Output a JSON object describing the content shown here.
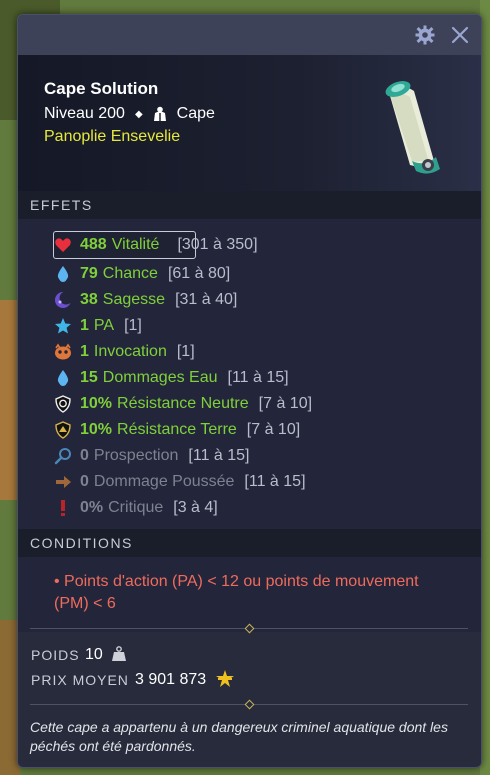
{
  "header": {
    "name": "Cape Solution",
    "level": "Niveau 200",
    "type": "Cape",
    "set": "Panoplie Ensevelie"
  },
  "effects_title": "EFFETS",
  "effects": [
    {
      "value": "488",
      "label": "Vitalité",
      "range": "[301 à 350]",
      "icon": "heart-icon",
      "active": true
    },
    {
      "value": "79",
      "label": "Chance",
      "range": "[61 à 80]",
      "icon": "water-drop-icon",
      "active": true
    },
    {
      "value": "38",
      "label": "Sagesse",
      "range": "[31 à 40]",
      "icon": "moon-icon",
      "active": true
    },
    {
      "value": "1",
      "label": "PA",
      "range": "[1]",
      "icon": "star-icon",
      "active": true
    },
    {
      "value": "1",
      "label": "Invocation",
      "range": "[1]",
      "icon": "invocation-icon",
      "active": true
    },
    {
      "value": "15",
      "label": "Dommages Eau",
      "range": "[11 à 15]",
      "icon": "water-drop-icon",
      "active": true
    },
    {
      "value": "10%",
      "label": "Résistance Neutre",
      "range": "[7 à 10]",
      "icon": "neutral-shield-icon",
      "active": true
    },
    {
      "value": "10%",
      "label": "Résistance Terre",
      "range": "[7 à 10]",
      "icon": "earth-shield-icon",
      "active": true
    },
    {
      "value": "0",
      "label": "Prospection",
      "range": "[11 à 15]",
      "icon": "magnifier-icon",
      "active": false
    },
    {
      "value": "0",
      "label": "Dommage Poussée",
      "range": "[11 à 15]",
      "icon": "push-arrow-icon",
      "active": false
    },
    {
      "value": "0%",
      "label": "Critique",
      "range": "[3 à 4]",
      "icon": "critical-icon",
      "active": false
    }
  ],
  "conditions_title": "CONDITIONS",
  "conditions_text": "• Points d'action (PA) < 12 ou points de mouvement (PM) < 6",
  "weight_label": "POIDS",
  "weight_value": "10",
  "price_label": "PRIX MOYEN",
  "price_value": "3 901 873",
  "description": "Cette cape a appartenu à un dangereux criminel aquatique dont les péchés ont été pardonnés.",
  "colors": {
    "bonus": "#7fd03a",
    "inactive": "#7d8190",
    "condition": "#ef6b5d",
    "set": "#e6e83b"
  }
}
